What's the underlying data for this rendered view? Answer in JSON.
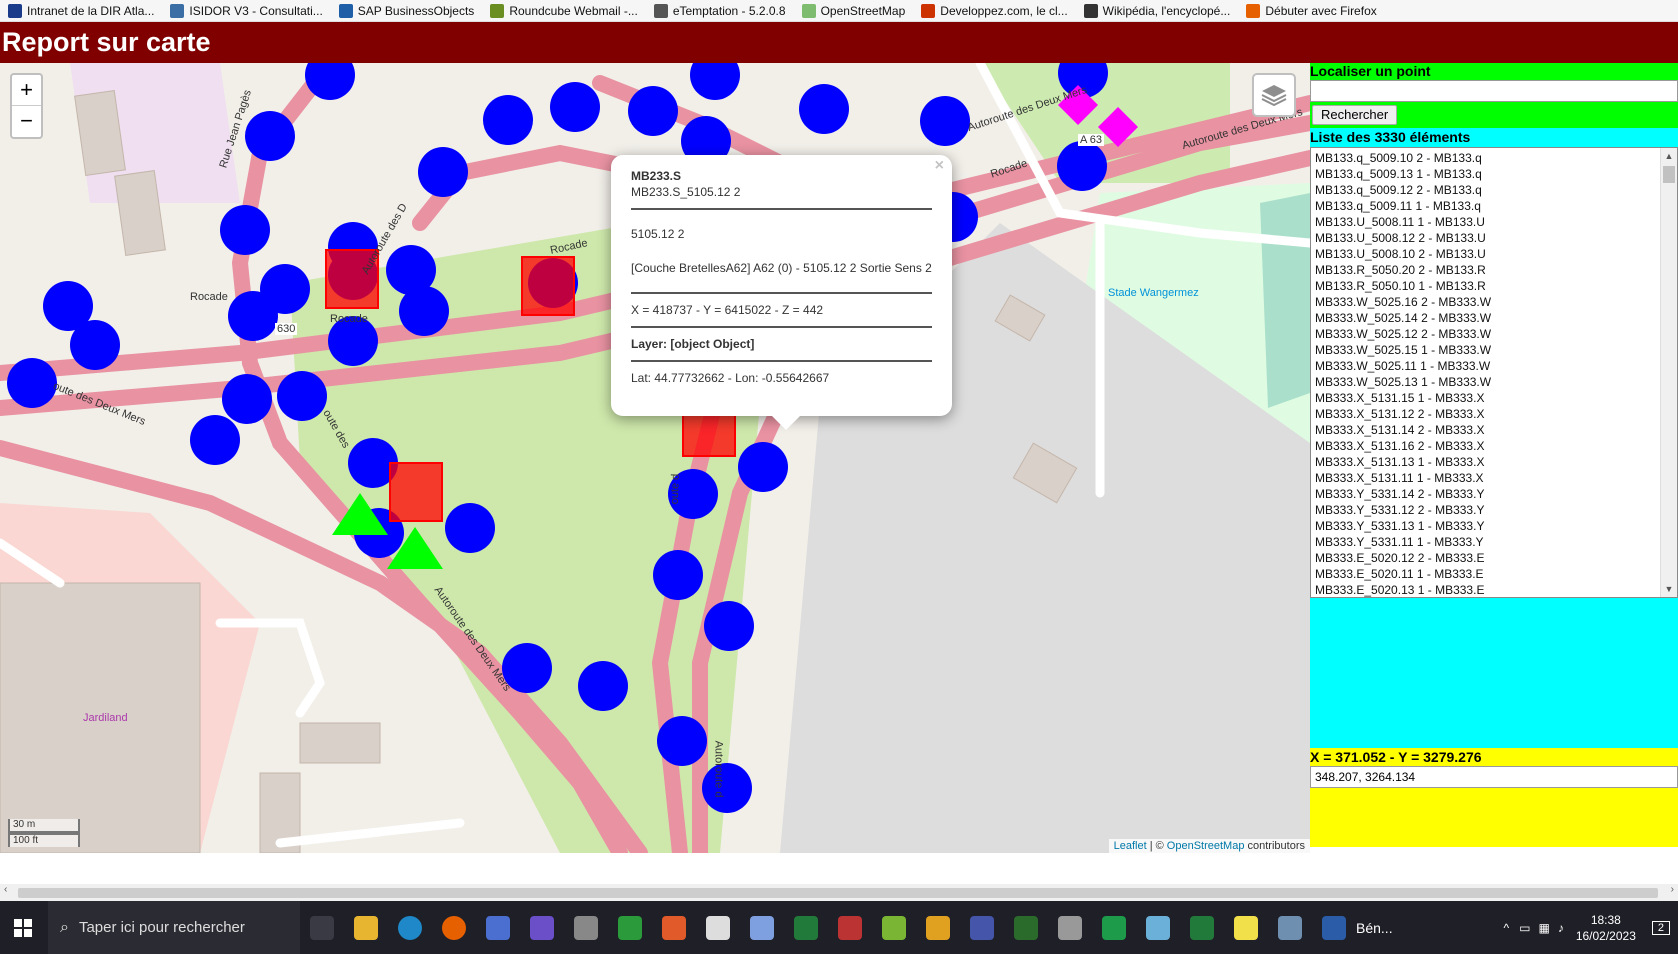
{
  "bookmarks": [
    {
      "label": "Intranet de la DIR Atla...",
      "color": "#1a3a8a"
    },
    {
      "label": "ISIDOR V3 - Consultati...",
      "color": "#3a6ea5"
    },
    {
      "label": "SAP BusinessObjects",
      "color": "#1f5fa8"
    },
    {
      "label": "Roundcube Webmail -...",
      "color": "#6b8e23"
    },
    {
      "label": "eTemptation - 5.2.0.8",
      "color": "#555555"
    },
    {
      "label": "OpenStreetMap",
      "color": "#7ebc6f"
    },
    {
      "label": "Developpez.com, le cl...",
      "color": "#cc3300"
    },
    {
      "label": "Wikipédia, l'encyclopé...",
      "color": "#333333"
    },
    {
      "label": "Débuter avec Firefox",
      "color": "#e66000"
    }
  ],
  "app": {
    "title": "Report sur carte"
  },
  "map": {
    "zoom_in": "+",
    "zoom_out": "−",
    "labels": {
      "rocade1": "Rocade",
      "rocade2": "Rocade",
      "rocade3": "Rocade",
      "rocade4": "Rocade",
      "a630": "630",
      "a63": "A 63",
      "deux_mers1": "Autoroute des Deux Mers",
      "deux_mers2": "Autoroute des Deux Mers",
      "deux_mers3": "Autoroute des Deux Mers",
      "deux_mers_left": "oute des Deux Mers",
      "route_des": "oute des",
      "autoroute_des_d": "Autoroute des D",
      "autoroute_d": "Autoroute d",
      "rue_jean_pages": "Rue Jean Pagès",
      "stade": "Stade Wangermez",
      "jardiland": "Jardiland",
      "route_d": "oute d"
    },
    "scale": {
      "metric": "30 m",
      "imperial": "100 ft"
    },
    "attribution": {
      "leaflet": "Leaflet",
      "sep": "| ©",
      "osm": "OpenStreetMap",
      "suffix": "contributors"
    },
    "colors": {
      "marker": "#0000ff",
      "square": "#ff0000",
      "triangle": "#00ff00",
      "diamond": "#ff00ff",
      "road": "#e892a2"
    }
  },
  "popup": {
    "title": "MB233.S",
    "subtitle": "MB233.S_5105.12 2",
    "line1": "5105.12 2",
    "line2": "[Couche BretellesA62] A62 (0) - 5105.12 2 Sortie Sens 2",
    "coords": "X = 418737 - Y = 6415022 - Z = 442",
    "layer": "Layer: [object Object]",
    "latlon": "Lat: 44.77732662 - Lon: -0.55642667",
    "close": "×"
  },
  "sidebar": {
    "locate_title": "Localiser un point",
    "search_button": "Rechercher",
    "list_title": "Liste des 3330 éléments",
    "items": [
      "MB133.q_5009.10 2 - MB133.q",
      "MB133.q_5009.13 1 - MB133.q",
      "MB133.q_5009.12 2 - MB133.q",
      "MB133.q_5009.11 1 - MB133.q",
      "MB133.U_5008.11 1 - MB133.U",
      "MB133.U_5008.12 2 - MB133.U",
      "MB133.U_5008.10 2 - MB133.U",
      "MB133.R_5050.20 2 - MB133.R",
      "MB133.R_5050.10 1 - MB133.R",
      "MB333.W_5025.16 2 - MB333.W",
      "MB333.W_5025.14 2 - MB333.W",
      "MB333.W_5025.12 2 - MB333.W",
      "MB333.W_5025.15 1 - MB333.W",
      "MB333.W_5025.11 1 - MB333.W",
      "MB333.W_5025.13 1 - MB333.W",
      "MB333.X_5131.15 1 - MB333.X",
      "MB333.X_5131.12 2 - MB333.X",
      "MB333.X_5131.14 2 - MB333.X",
      "MB333.X_5131.16 2 - MB333.X",
      "MB333.X_5131.13 1 - MB333.X",
      "MB333.X_5131.11 1 - MB333.X",
      "MB333.Y_5331.14 2 - MB333.Y",
      "MB333.Y_5331.12 2 - MB333.Y",
      "MB333.Y_5331.13 1 - MB333.Y",
      "MB333.Y_5331.11 1 - MB333.Y",
      "MB333.E_5020.12 2 - MB333.E",
      "MB333.E_5020.11 1 - MB333.E",
      "MB333.E_5020.13 1 - MB333.E"
    ],
    "coord_title": "X = 371.052 - Y = 3279.276",
    "coord_value": "348.207, 3264.134"
  },
  "taskbar": {
    "search_placeholder": "Taper ici pour rechercher",
    "app_label": "Bén...",
    "time": "18:38",
    "date": "16/02/2023",
    "notifications": "2"
  }
}
